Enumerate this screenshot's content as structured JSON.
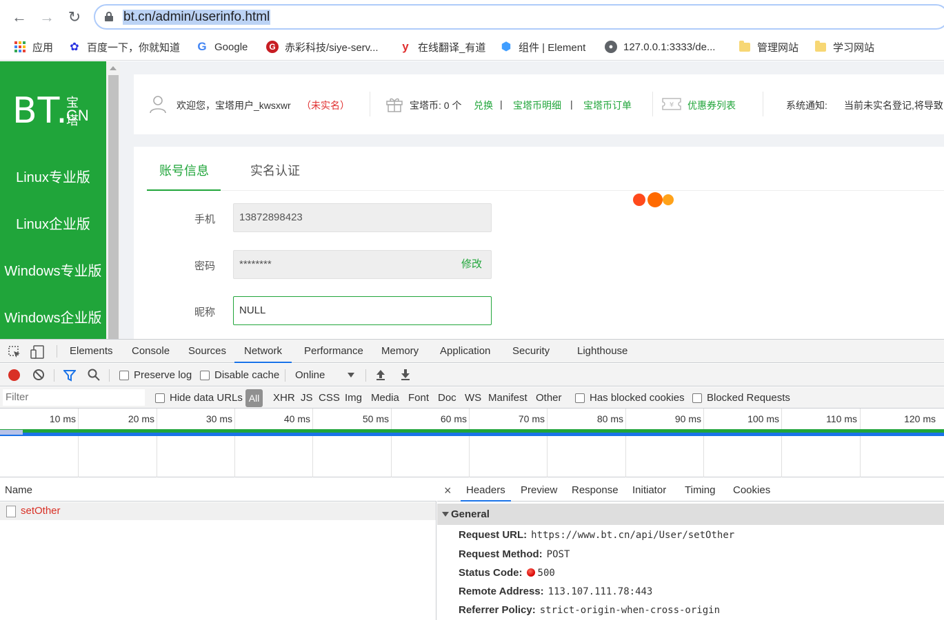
{
  "browser": {
    "url": "bt.cn/admin/userinfo.html",
    "bookmarks": [
      {
        "label": "应用"
      },
      {
        "label": "百度一下，你就知道"
      },
      {
        "label": "Google"
      },
      {
        "label": "赤彩科技/siye-serv..."
      },
      {
        "label": "在线翻译_有道"
      },
      {
        "label": "组件 | Element"
      },
      {
        "label": "127.0.0.1:3333/de..."
      },
      {
        "label": "管理网站"
      },
      {
        "label": "学习网站"
      }
    ]
  },
  "sidebar": {
    "logo_main": "BT.",
    "logo_cn_top": "宝塔",
    "logo_cn_bottom": "CN",
    "items": [
      {
        "label": "Linux专业版"
      },
      {
        "label": "Linux企业版"
      },
      {
        "label": "Windows专业版"
      },
      {
        "label": "Windows企业版"
      }
    ]
  },
  "infobar": {
    "welcome": "欢迎您，宝塔用户_kwsxwr",
    "unverified": "（未实名）",
    "coins": "宝塔币: 0 个",
    "exchange": "兑换",
    "sep": "|",
    "coin_detail": "宝塔币明细",
    "coin_orders": "宝塔币订单",
    "coupons": "优惠券列表",
    "notice_label": "系统通知:",
    "notice_text": "当前未实名登记,将导致"
  },
  "account": {
    "tabs": [
      {
        "label": "账号信息"
      },
      {
        "label": "实名认证"
      }
    ],
    "phone_label": "手机",
    "phone_value": "13872898423",
    "password_label": "密码",
    "password_value": "********",
    "password_edit": "修改",
    "nickname_label": "昵称",
    "nickname_value": "NULL"
  },
  "devtools": {
    "tabs": [
      {
        "label": "Elements"
      },
      {
        "label": "Console"
      },
      {
        "label": "Sources"
      },
      {
        "label": "Network"
      },
      {
        "label": "Performance"
      },
      {
        "label": "Memory"
      },
      {
        "label": "Application"
      },
      {
        "label": "Security"
      },
      {
        "label": "Lighthouse"
      }
    ],
    "active_tab": "Network",
    "toolbar": {
      "preserve_log": "Preserve log",
      "disable_cache": "Disable cache",
      "throttle": "Online"
    },
    "filter": {
      "placeholder": "Filter",
      "hide_data_urls": "Hide data URLs",
      "types": [
        "All",
        "XHR",
        "JS",
        "CSS",
        "Img",
        "Media",
        "Font",
        "Doc",
        "WS",
        "Manifest",
        "Other"
      ],
      "has_blocked_cookies": "Has blocked cookies",
      "blocked_requests": "Blocked Requests"
    },
    "timeline_ticks": [
      "10 ms",
      "20 ms",
      "30 ms",
      "40 ms",
      "50 ms",
      "60 ms",
      "70 ms",
      "80 ms",
      "90 ms",
      "100 ms",
      "110 ms",
      "120 ms"
    ],
    "requests": {
      "header": "Name",
      "rows": [
        {
          "name": "setOther"
        }
      ]
    },
    "detail": {
      "close": "×",
      "tabs": [
        {
          "label": "Headers"
        },
        {
          "label": "Preview"
        },
        {
          "label": "Response"
        },
        {
          "label": "Initiator"
        },
        {
          "label": "Timing"
        },
        {
          "label": "Cookies"
        }
      ],
      "section": "General",
      "fields": [
        {
          "key": "Request URL:",
          "value": "https://www.bt.cn/api/User/setOther"
        },
        {
          "key": "Request Method:",
          "value": "POST"
        },
        {
          "key": "Status Code:",
          "value": "500"
        },
        {
          "key": "Remote Address:",
          "value": "113.107.111.78:443"
        },
        {
          "key": "Referrer Policy:",
          "value": "strict-origin-when-cross-origin"
        }
      ]
    }
  },
  "colors": {
    "brand_green": "#20a53a",
    "error_red": "#d93025",
    "devtools_blue": "#1a73e8"
  }
}
